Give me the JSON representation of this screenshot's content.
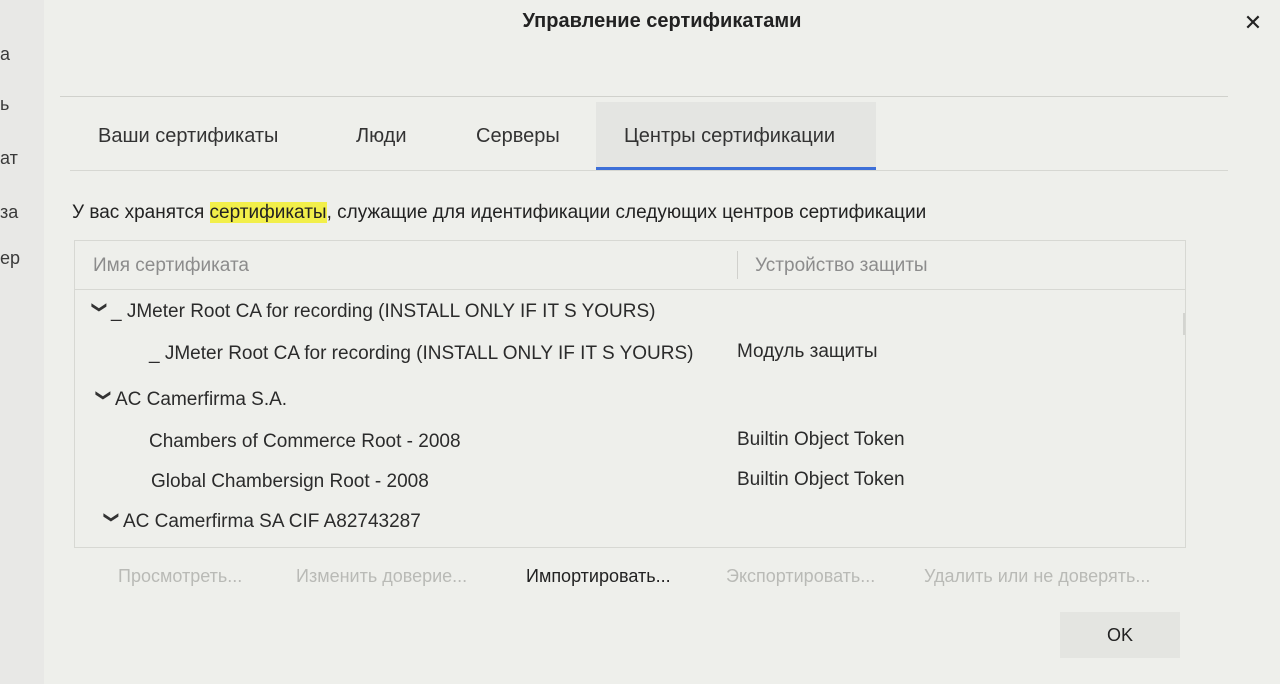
{
  "background": {
    "fragments": [
      "a",
      "ь",
      "ат",
      "за",
      "ер"
    ]
  },
  "dialog": {
    "title": "Управление сертификатами",
    "close_label": "✕"
  },
  "tabs": [
    {
      "label": "Ваши сертификаты",
      "active": false
    },
    {
      "label": "Люди",
      "active": false
    },
    {
      "label": "Серверы",
      "active": false
    },
    {
      "label": "Центры сертификации",
      "active": true
    }
  ],
  "description": {
    "before": "У вас хранятся ",
    "highlight": "сертификаты",
    "after": ", служащие для идентификации следующих центров сертификации"
  },
  "table": {
    "columns": [
      "Имя сертификата",
      "Устройство защиты"
    ],
    "column_picker_icon": "⊞",
    "rows": [
      {
        "type": "group",
        "name": "_ JMeter Root CA for recording (INSTALL ONLY IF IT S YOURS)",
        "device": ""
      },
      {
        "type": "item",
        "name": "_ JMeter Root CA for recording (INSTALL ONLY IF IT S YOURS)",
        "device": "Модуль защиты"
      },
      {
        "type": "group",
        "name": "AC Camerfirma S.A.",
        "device": ""
      },
      {
        "type": "item",
        "name": "Chambers of Commerce Root - 2008",
        "device": "Builtin Object Token"
      },
      {
        "type": "item",
        "name": "Global Chambersign Root - 2008",
        "device": "Builtin Object Token"
      },
      {
        "type": "group",
        "name": "AC Camerfirma SA CIF A82743287",
        "device": ""
      }
    ],
    "expand_icon": "❯"
  },
  "buttons": {
    "view": "Просмотреть...",
    "edit_trust": "Изменить доверие...",
    "import": "Импортировать...",
    "export": "Экспортировать...",
    "delete": "Удалить или не доверять..."
  },
  "ok_label": "OK",
  "colors": {
    "accent": "#3d6fd8",
    "highlight": "#f2ef4a",
    "disabled": "#b9bab6"
  }
}
